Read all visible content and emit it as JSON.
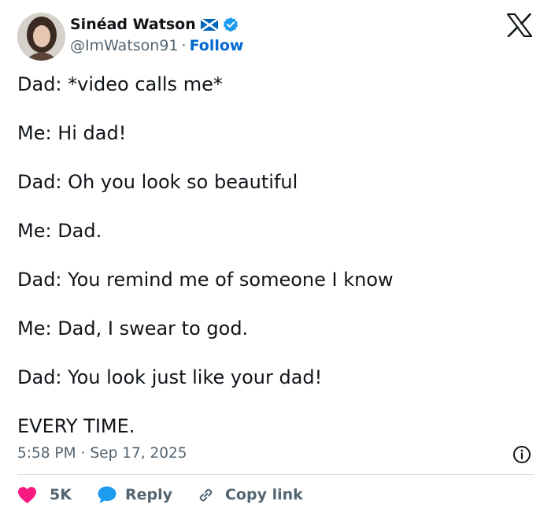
{
  "user": {
    "display_name": "Sinéad Watson",
    "handle": "@ImWatson91",
    "separator": "·",
    "follow_label": "Follow"
  },
  "tweet": {
    "lines": [
      "Dad: *video calls me*",
      "Me: Hi dad!",
      "Dad: Oh you look so beautiful",
      "Me: Dad.",
      "Dad: You remind me of someone I know",
      "Me: Dad, I swear to god.",
      "Dad: You look just like your dad!",
      "EVERY TIME."
    ],
    "time": "5:58 PM",
    "separator": "·",
    "date": "Sep 17, 2025"
  },
  "actions": {
    "like_count": "5K",
    "reply_label": "Reply",
    "copy_label": "Copy link"
  },
  "icons": {
    "flag": "scotland-flag-icon",
    "verified": "verified-badge-icon",
    "logo": "x-logo-icon",
    "info": "info-icon",
    "like": "heart-icon",
    "reply": "speech-bubble-icon",
    "copy": "link-icon"
  },
  "colors": {
    "text": "#0f1419",
    "secondary": "#536471",
    "link": "#0069d1",
    "verified": "#1d9bf0",
    "like": "#f91880",
    "divider": "#cfd9de"
  }
}
